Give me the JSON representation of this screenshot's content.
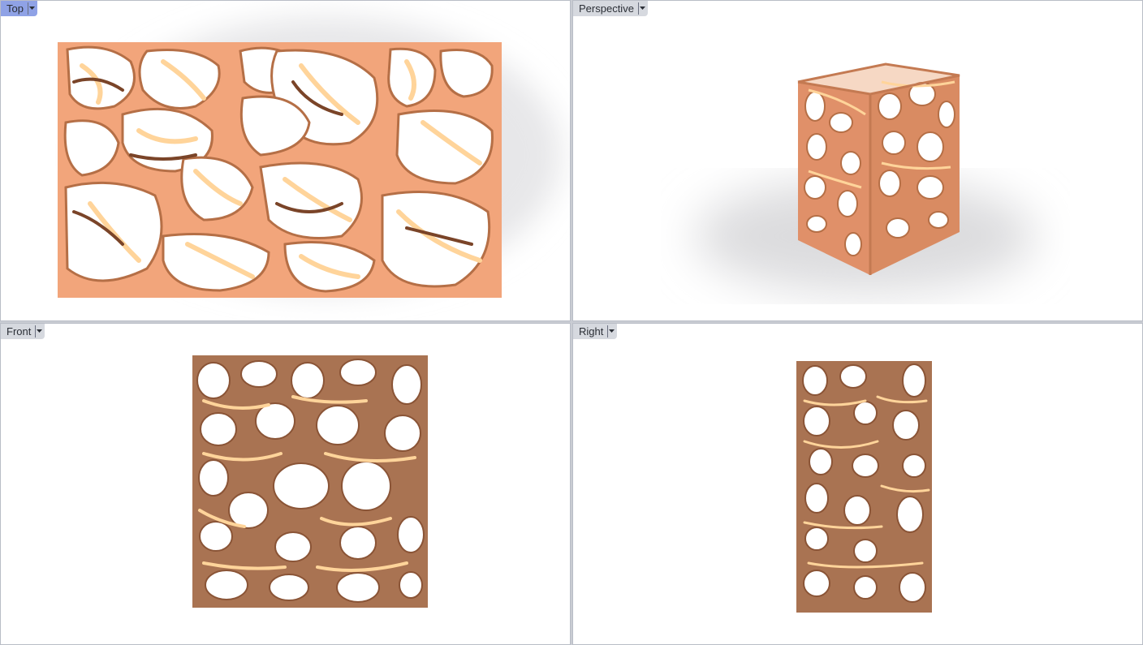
{
  "viewports": {
    "top": {
      "label": "Top",
      "active": true
    },
    "perspective": {
      "label": "Perspective",
      "active": false
    },
    "front": {
      "label": "Front",
      "active": false
    },
    "right": {
      "label": "Right",
      "active": false
    }
  },
  "colors": {
    "active_tab": "#8fa2e6",
    "inactive_tab": "#d6d9df",
    "top_panel_face": "#f2a57b",
    "front_panel_face": "#a97352",
    "light_strut": "#ffd49a",
    "dark_void": "#5a3521"
  },
  "icons": {
    "viewport_menu": "chevron-down-icon"
  }
}
